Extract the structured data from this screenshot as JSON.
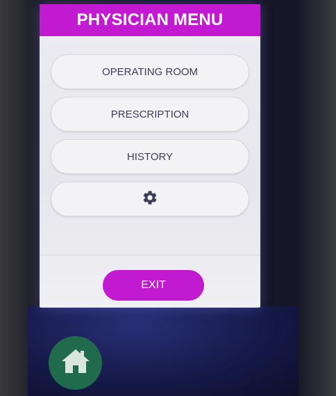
{
  "header": {
    "title": "PHYSICIAN MENU"
  },
  "menu": {
    "items": [
      {
        "label": "OPERATING ROOM"
      },
      {
        "label": "PRESCRIPTION"
      },
      {
        "label": "HISTORY"
      },
      {
        "icon": "gear-icon"
      }
    ]
  },
  "footer": {
    "exit_label": "EXIT"
  },
  "device": {
    "home_icon": "home-icon"
  },
  "colors": {
    "accent": "#c21ad0",
    "home_button": "#1f6b4b"
  }
}
